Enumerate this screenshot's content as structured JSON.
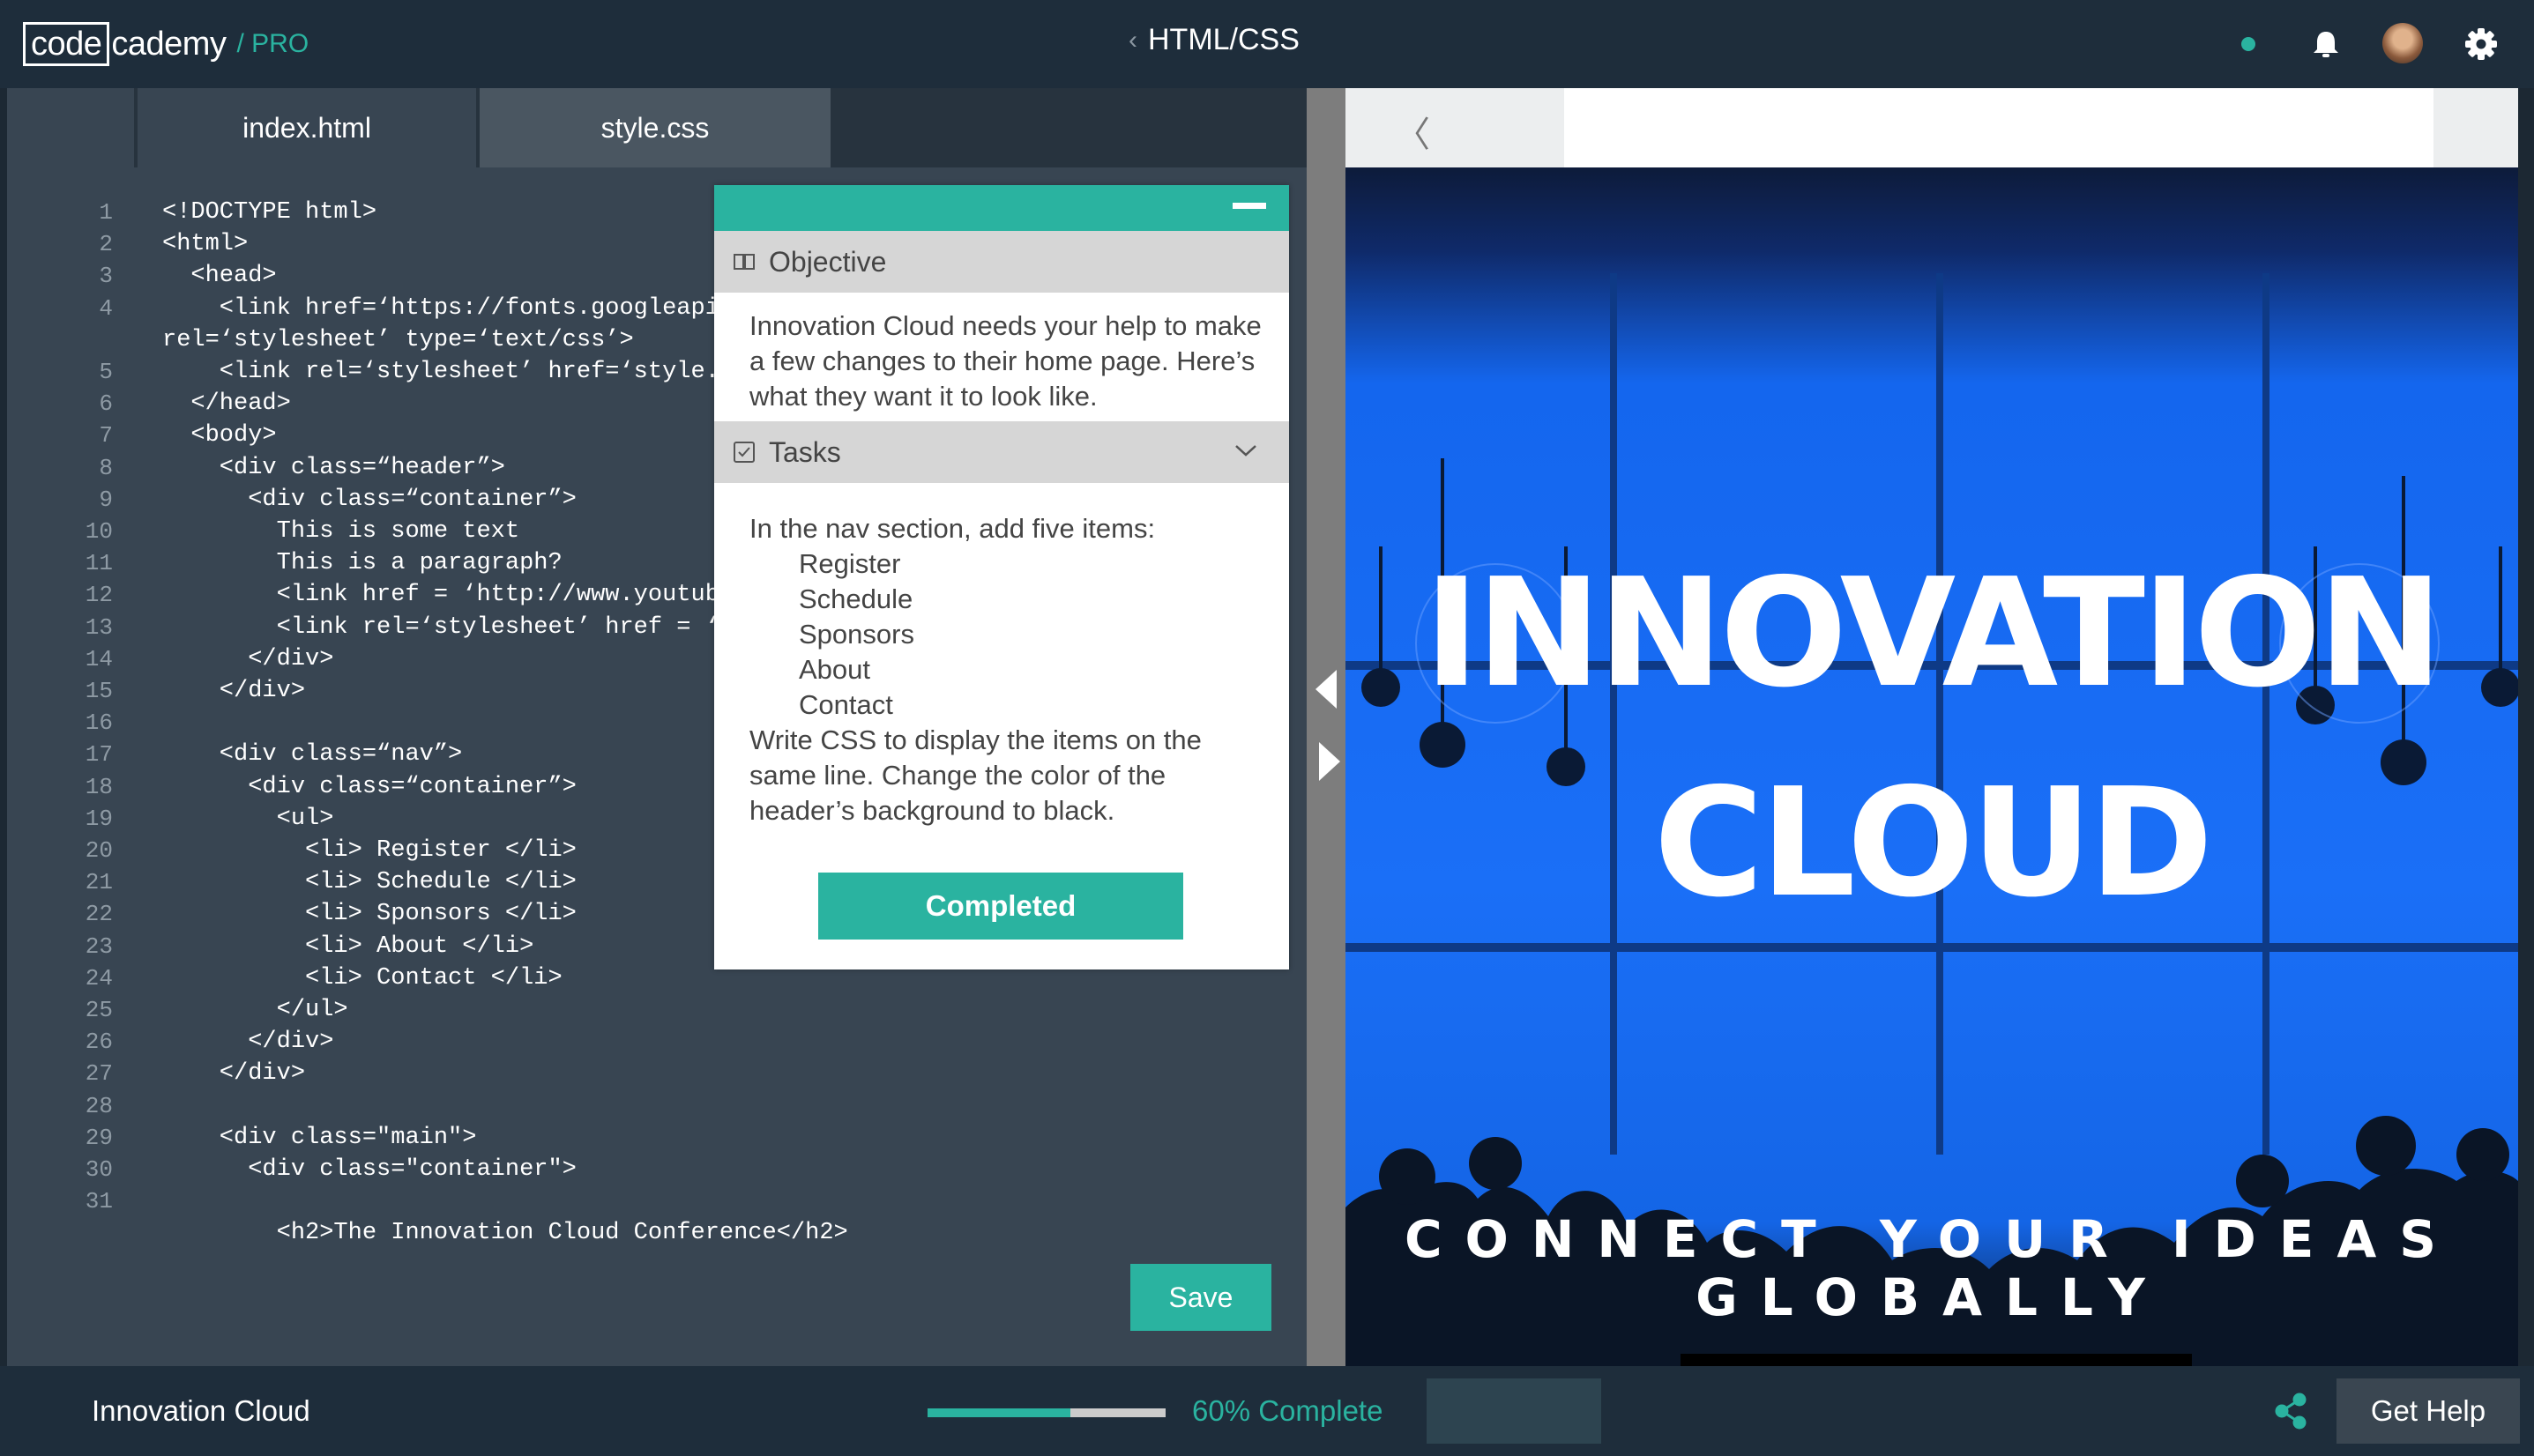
{
  "header": {
    "logo_code": "code",
    "logo_rest": "cademy",
    "logo_pro": "/ PRO",
    "course_title": "HTML/CSS",
    "back_chevron": "‹"
  },
  "colors": {
    "accent": "#2ab3a0",
    "topbar": "#1e2d3b",
    "editor_bg": "#384552",
    "hero_blue": "#1a6ff7"
  },
  "editor": {
    "tabs": [
      {
        "label": "index.html"
      },
      {
        "label": "style.css"
      }
    ],
    "lines": [
      {
        "n": "1",
        "code": "<!DOCTYPE html>"
      },
      {
        "n": "2",
        "code": "<html>"
      },
      {
        "n": "3",
        "code": "  <head>"
      },
      {
        "n": "4",
        "code": "    <link href=‘https://fonts.googleapis"
      },
      {
        "n": "",
        "code": "rel=‘stylesheet’ type=‘text/css’>"
      },
      {
        "n": "5",
        "code": "    <link rel=‘stylesheet’ href=‘style.c"
      },
      {
        "n": "6",
        "code": "  </head>"
      },
      {
        "n": "7",
        "code": "  <body>"
      },
      {
        "n": "8",
        "code": "    <div class=“header”>"
      },
      {
        "n": "9",
        "code": "      <div class=“container”>"
      },
      {
        "n": "10",
        "code": "        This is some text"
      },
      {
        "n": "11",
        "code": "        This is a paragraph?"
      },
      {
        "n": "12",
        "code": "        <link href = ‘http://www.youtube"
      },
      {
        "n": "13",
        "code": "        <link rel=‘stylesheet’ href = ‘s"
      },
      {
        "n": "14",
        "code": "      </div>"
      },
      {
        "n": "15",
        "code": "    </div>"
      },
      {
        "n": "16",
        "code": ""
      },
      {
        "n": "17",
        "code": "    <div class=“nav”>"
      },
      {
        "n": "18",
        "code": "      <div class=“container”>"
      },
      {
        "n": "19",
        "code": "        <ul>"
      },
      {
        "n": "20",
        "code": "          <li> Register </li>"
      },
      {
        "n": "21",
        "code": "          <li> Schedule </li>"
      },
      {
        "n": "22",
        "code": "          <li> Sponsors </li>"
      },
      {
        "n": "23",
        "code": "          <li> About </li>"
      },
      {
        "n": "24",
        "code": "          <li> Contact </li>"
      },
      {
        "n": "25",
        "code": "        </ul>"
      },
      {
        "n": "26",
        "code": "      </div>"
      },
      {
        "n": "27",
        "code": "    </div>"
      },
      {
        "n": "28",
        "code": ""
      },
      {
        "n": "29",
        "code": "    <div class=\"main\">"
      },
      {
        "n": "30",
        "code": "      <div class=\"container\">"
      },
      {
        "n": "31",
        "code": ""
      },
      {
        "n": "",
        "code": "        <h2>The Innovation Cloud Conference</h2>"
      }
    ],
    "save_label": "Save"
  },
  "panel": {
    "objective_label": "Objective",
    "objective_text": "Innovation Cloud needs your help to make a few changes to their home page. Here’s what they want it to look like.",
    "tasks_label": "Tasks",
    "tasks_intro": "In the nav section, add five items:",
    "task_items": [
      "Register",
      "Schedule",
      "Sponsors",
      "About",
      "Contact"
    ],
    "tasks_outro": "Write CSS to display the items on the same line. Change the color of the header’s background to black.",
    "completed_label": "Completed"
  },
  "preview": {
    "back": "〈",
    "title_line1": "INNOVATION",
    "title_line2": "CLOUD",
    "tagline_line1": "CONNECT YOUR IDEAS",
    "tagline_line2": "GLOBALLY"
  },
  "footer": {
    "project_name": "Innovation Cloud",
    "progress_fraction": 0.6,
    "progress_label": "60% Complete",
    "help_label": "Get Help"
  }
}
